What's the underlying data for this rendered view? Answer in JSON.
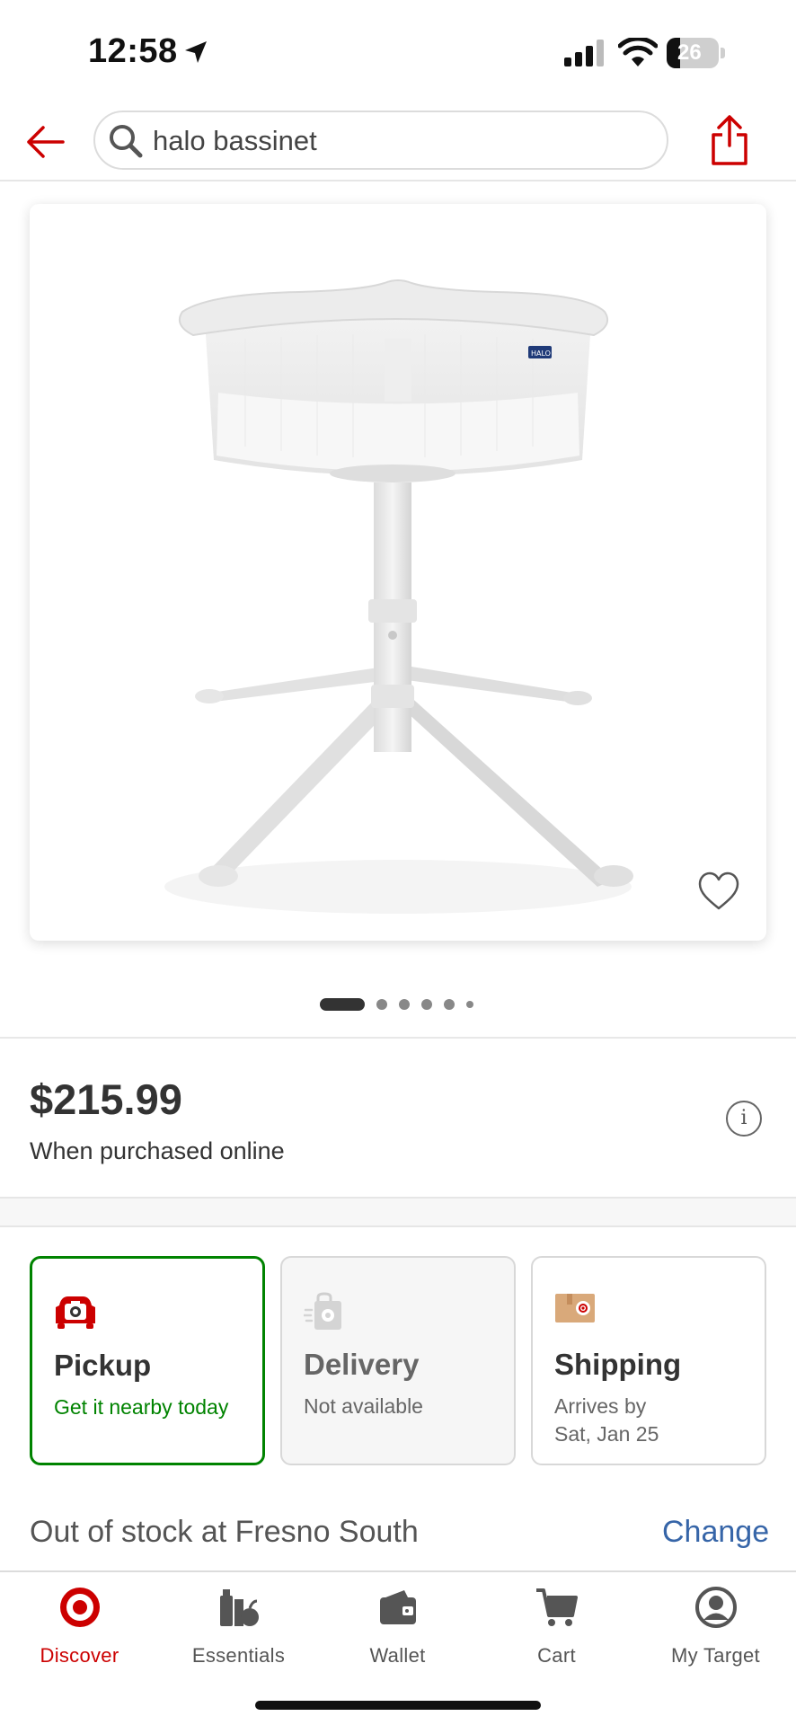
{
  "status_bar": {
    "time": "12:58",
    "battery": "26",
    "battery_level": 0.26
  },
  "header": {
    "search_query": "halo bassinet"
  },
  "product": {
    "image_alt": "HALO bassinet",
    "image_count": 6,
    "active_image": 1,
    "price": "$215.99",
    "price_note": "When purchased online"
  },
  "fulfillment": [
    {
      "title": "Pickup",
      "subtitle": "Get it nearby today",
      "state": "selected"
    },
    {
      "title": "Delivery",
      "subtitle": "Not available",
      "state": "disabled"
    },
    {
      "title": "Shipping",
      "subtitle_line1": "Arrives by",
      "subtitle_line2": "Sat, Jan 25",
      "state": "default"
    }
  ],
  "stock": {
    "text": "Out of stock at Fresno South",
    "change_label": "Change"
  },
  "bottom_nav": [
    {
      "label": "Discover",
      "icon": "target-bullseye-icon",
      "active": true
    },
    {
      "label": "Essentials",
      "icon": "essentials-icon",
      "active": false
    },
    {
      "label": "Wallet",
      "icon": "wallet-icon",
      "active": false
    },
    {
      "label": "Cart",
      "icon": "cart-icon",
      "active": false
    },
    {
      "label": "My Target",
      "icon": "account-icon",
      "active": false
    }
  ],
  "colors": {
    "accent": "#cc0000",
    "success": "#008300",
    "link": "#3665a8"
  }
}
